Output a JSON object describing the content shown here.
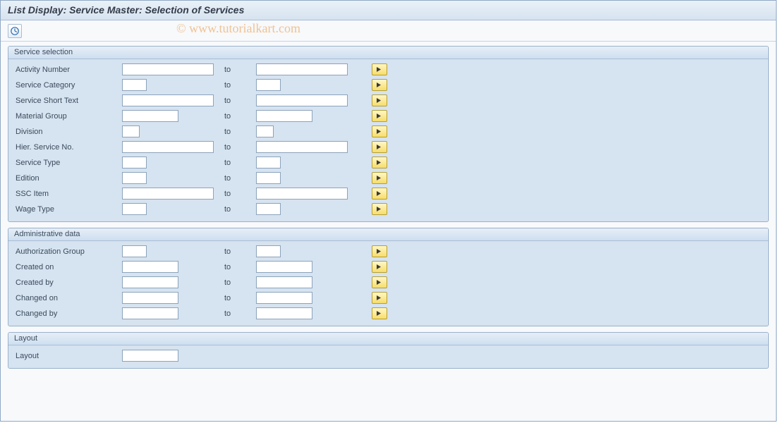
{
  "page_title": "List Display: Service Master: Selection of Services",
  "watermark": "© www.tutorialkart.com",
  "to_label": "to",
  "sections": {
    "service": {
      "title": "Service selection",
      "rows": {
        "activity_number": "Activity Number",
        "service_category": "Service Category",
        "service_short_text": "Service Short Text",
        "material_group": "Material Group",
        "division": "Division",
        "hier_service_no": "Hier. Service No.",
        "service_type": "Service Type",
        "edition": "Edition",
        "ssc_item": "SSC Item",
        "wage_type": "Wage Type"
      }
    },
    "admin": {
      "title": "Administrative data",
      "rows": {
        "auth_group": "Authorization Group",
        "created_on": "Created on",
        "created_by": "Created by",
        "changed_on": "Changed on",
        "changed_by": "Changed by"
      }
    },
    "layout": {
      "title": "Layout",
      "row_label": "Layout"
    }
  }
}
